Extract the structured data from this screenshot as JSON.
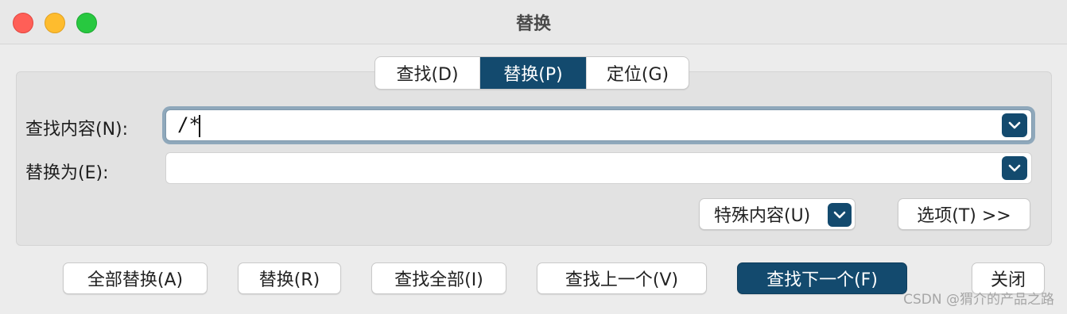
{
  "window": {
    "title": "替换"
  },
  "tabs": [
    {
      "label": "查找(D)",
      "active": false
    },
    {
      "label": "替换(P)",
      "active": true
    },
    {
      "label": "定位(G)",
      "active": false
    }
  ],
  "find": {
    "label": "查找内容(N):",
    "value": "/*"
  },
  "replace": {
    "label": "替换为(E):",
    "value": ""
  },
  "options_row": {
    "special_label": "特殊内容(U)",
    "options_label": "选项(T) >>"
  },
  "footer": {
    "replace_all": "全部替换(A)",
    "replace": "替换(R)",
    "find_all": "查找全部(I)",
    "find_prev": "查找上一个(V)",
    "find_next": "查找下一个(F)",
    "close": "关闭"
  },
  "watermark": "CSDN @猬介的产品之路",
  "colors": {
    "accent": "#134a6e",
    "close": "#ff5f57",
    "minimize": "#febc2e",
    "maximize": "#28c840"
  },
  "icons": {
    "dropdown": "chevron-down-icon"
  }
}
